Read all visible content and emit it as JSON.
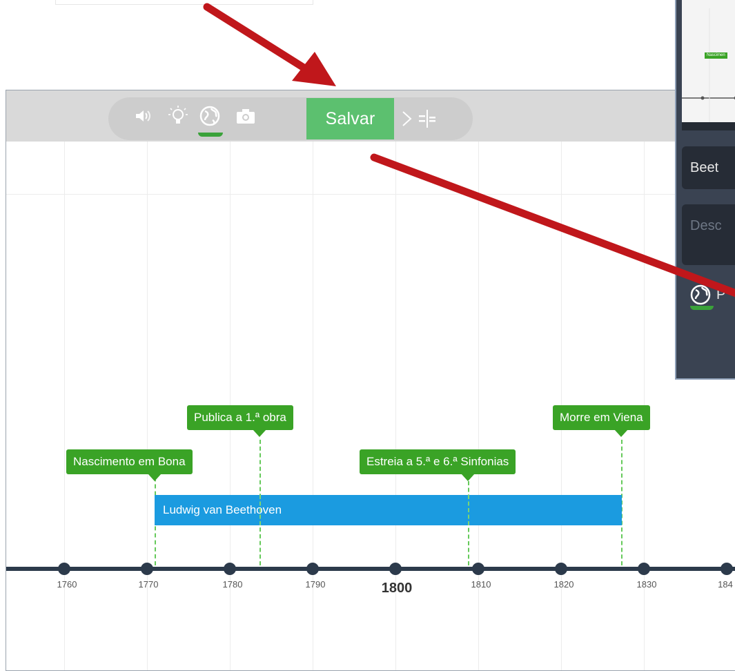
{
  "toolbar": {
    "icons": [
      "speaker-icon",
      "lightbulb-icon",
      "globe-icon",
      "camera-icon"
    ],
    "save_label": "Salvar",
    "next_icon": "chevron-right-icon",
    "split_icon": "split-icon"
  },
  "timeline": {
    "ticks": [
      "1760",
      "1770",
      "1780",
      "1790",
      "1800",
      "1810",
      "1820",
      "1830",
      "184"
    ],
    "major_tick": "1800",
    "period": {
      "label": "Ludwig van Beethoven",
      "start_year": 1770,
      "end_year": 1827,
      "color": "#1b9be0"
    },
    "events": [
      {
        "label": "Nascimento em Bona",
        "year": 1770
      },
      {
        "label": "Publica a 1.ª obra",
        "year": 1783
      },
      {
        "label": "Estreia a 5.ª e 6.ª Sinfonias",
        "year": 1808
      },
      {
        "label": "Morre em Viena",
        "year": 1827
      }
    ],
    "event_color": "#3aa326",
    "axis_color": "#2c3a4b"
  },
  "side_panel": {
    "thumbnail_label": "Nascimen",
    "name_value": "Beet",
    "description_placeholder": "Desc",
    "globe_text": "P"
  },
  "annotation_color": "#c0171b"
}
